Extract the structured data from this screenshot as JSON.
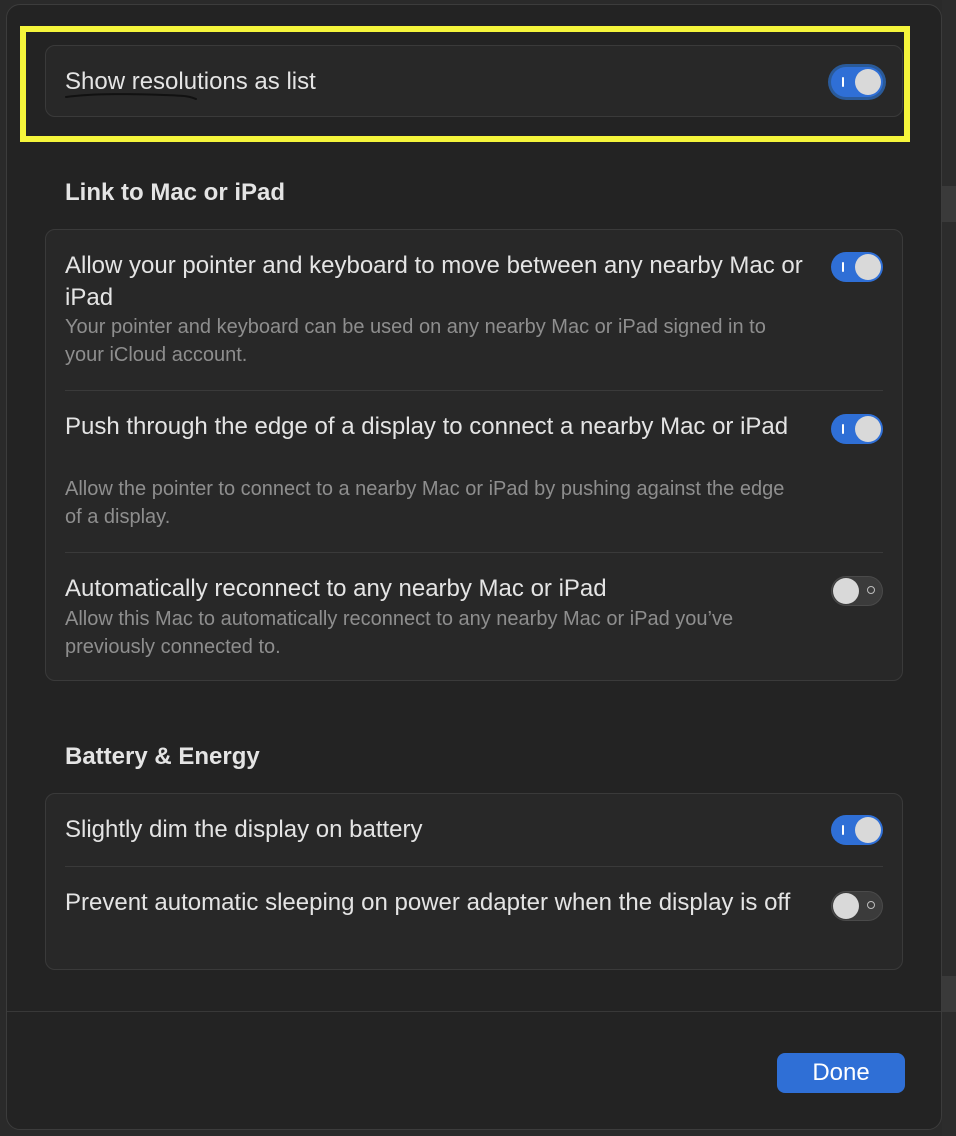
{
  "top_setting": {
    "label": "Show resolutions as list",
    "on": true
  },
  "link_section": {
    "heading": "Link to Mac or iPad",
    "items": [
      {
        "title": "Allow your pointer and keyboard to move between any nearby Mac or iPad",
        "description": "Your pointer and keyboard can be used on any nearby Mac or iPad signed in to your iCloud account.",
        "on": true
      },
      {
        "title": "Push through the edge of a display to connect a nearby Mac or iPad",
        "description": "Allow the pointer to connect to a nearby Mac or iPad by pushing against the edge of a display.",
        "on": true
      },
      {
        "title": "Automatically reconnect to any nearby Mac or iPad",
        "description": "Allow this Mac to automatically reconnect to any nearby Mac or iPad you’ve previously connected to.",
        "on": false
      }
    ]
  },
  "battery_section": {
    "heading": "Battery & Energy",
    "items": [
      {
        "title": "Slightly dim the display on battery",
        "on": true
      },
      {
        "title": "Prevent automatic sleeping on power adapter when the display is off",
        "on": false
      }
    ]
  },
  "footer": {
    "done_label": "Done"
  },
  "colors": {
    "accent": "#2f6fd6",
    "highlight": "#f5f53b",
    "background": "#232323"
  }
}
